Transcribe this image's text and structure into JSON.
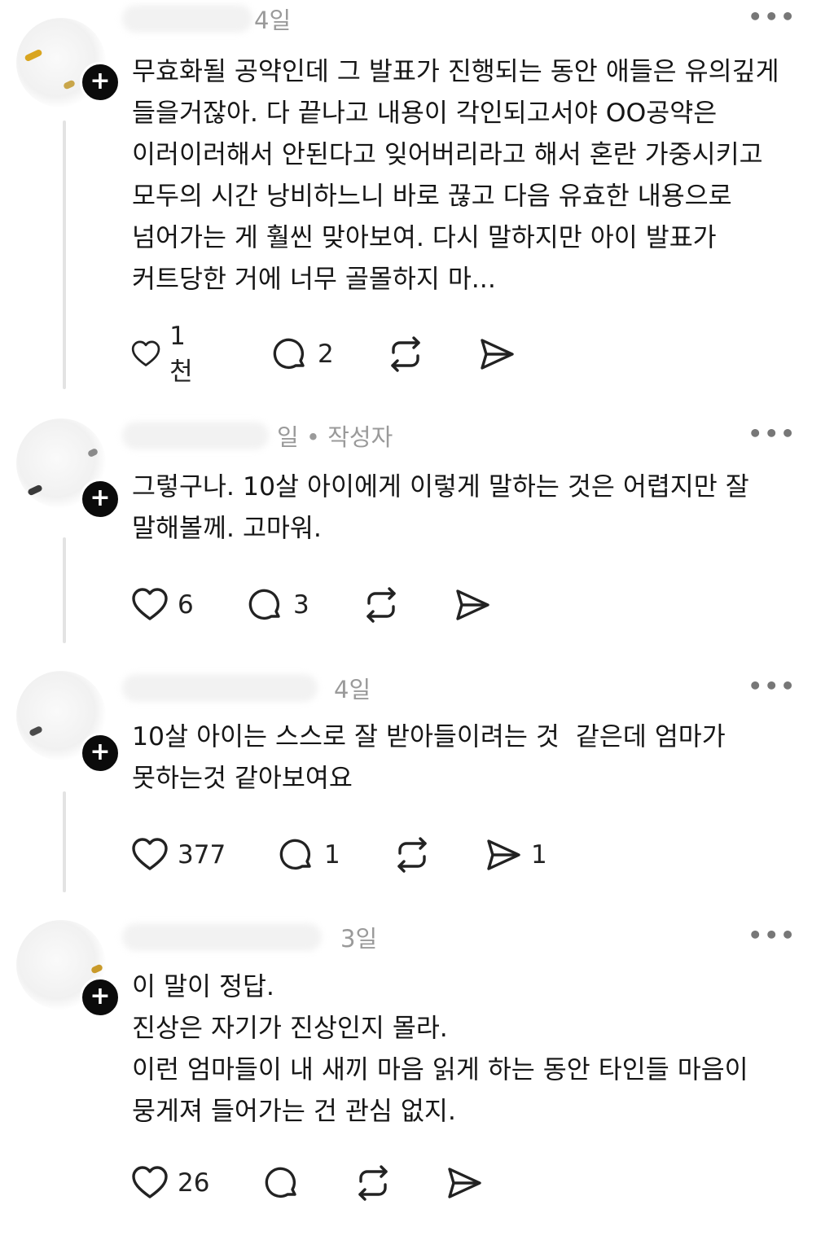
{
  "posts": [
    {
      "time": "4일",
      "author_badge": "",
      "text": "무효화될 공약인데 그 발표가 진행되는 동안 애들은 유의깊게\n들을거잖아. 다 끝나고 내용이 각인되고서야 OO공약은\n이러이러해서 안된다고 잊어버리라고 해서 혼란 가중시키고\n모두의 시간 낭비하느니 바로 끊고 다음 유효한 내용으로\n넘어가는 게 훨씬 맞아보여. 다시 말하지만 아이 발표가\n커트당한 거에 너무 골몰하지 마...",
      "likes": "1천",
      "replies": "2",
      "reposts": "",
      "shares": ""
    },
    {
      "time": "일 • 작성자",
      "author_badge": "",
      "text": "그렇구나. 10살 아이에게 이렇게 말하는 것은 어렵지만 잘\n말해볼께. 고마워.",
      "likes": "6",
      "replies": "3",
      "reposts": "",
      "shares": ""
    },
    {
      "time": "4일",
      "author_badge": "",
      "text": "10살 아이는 스스로 잘 받아들이려는 것  같은데 엄마가\n못하는것 같아보여요",
      "likes": "377",
      "replies": "1",
      "reposts": "",
      "shares": "1"
    },
    {
      "time": "3일",
      "author_badge": "",
      "text": "이 말이 정답.\n진상은 자기가 진상인지 몰라.\n이런 엄마들이 내 새끼 마음 읽게 하는 동안 타인들 마음이\n뭉게져 들어가는 건 관심 없지.",
      "likes": "26",
      "replies": "",
      "reposts": "",
      "shares": ""
    }
  ],
  "icons": {
    "like": "heart-icon",
    "reply": "comment-icon",
    "repost": "repost-icon",
    "share": "send-icon",
    "more": "more-icon",
    "follow": "plus-icon"
  },
  "labels": {
    "more": "•••",
    "follow": "+"
  }
}
